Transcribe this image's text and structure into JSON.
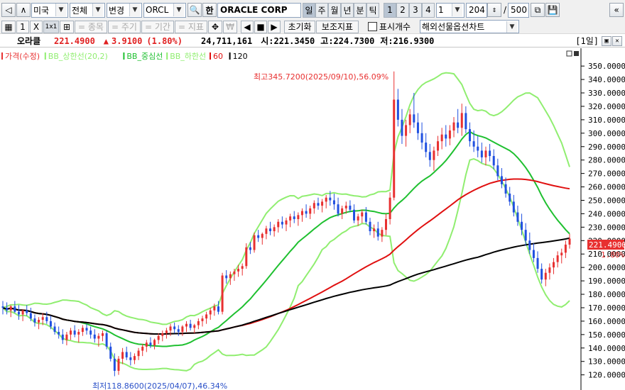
{
  "toolbar1": {
    "market": "미국",
    "scope": "전체",
    "change": "변경",
    "ticker": "ORCL",
    "hangul": "한",
    "company": "ORACLE CORP",
    "periods": [
      "일",
      "주",
      "월",
      "년",
      "분",
      "틱"
    ],
    "active_period": "일",
    "multi": [
      "1",
      "2",
      "3",
      "4"
    ],
    "interval": "1",
    "count": "204",
    "total_sep": "/",
    "total": "500"
  },
  "toolbar2": {
    "grid_nums": [
      "1",
      "X",
      "1x1"
    ],
    "disabled_buttons": [
      "= 종목",
      "= 주기",
      "= 기간",
      "= 지표"
    ],
    "buttons": [
      "초기화",
      "보조지표",
      "표시개수"
    ],
    "overseas": "해외선물옵션차트"
  },
  "info": {
    "name": "오라클",
    "price": "221.4900",
    "change_arrow": "▲",
    "change": "3.9100",
    "change_pct": "(1.80%)",
    "volume": "24,711,161",
    "open_label": "시:",
    "open": "221.3450",
    "high_label": "고:",
    "high": "224.7300",
    "low_label": "저:",
    "low": "216.9300",
    "pane_label": "[1일]"
  },
  "indicators": [
    {
      "label": "가격(수정)",
      "color": "#e83030"
    },
    {
      "label": "BB_상한선(20,2)",
      "color": "#90ee70"
    },
    {
      "label": "BB_중심선",
      "color": "#1fc030"
    },
    {
      "label": "BB_하한선",
      "color": "#90ee70"
    },
    {
      "label": "60",
      "color": "#e01010"
    },
    {
      "label": "120",
      "color": "#000000"
    }
  ],
  "annotations": {
    "high": "최고345.7200(2025/09/10),56.09%",
    "low": "최저118.8600(2025/04/07),46.34%"
  },
  "y_axis": {
    "ticks": [
      "350.0000",
      "340.0000",
      "330.0000",
      "320.0000",
      "310.0000",
      "300.0000",
      "290.0000",
      "280.0000",
      "270.0000",
      "260.0000",
      "250.0000",
      "240.0000",
      "230.0000",
      "220.0000",
      "210.0000",
      "200.0000",
      "190.0000",
      "180.0000",
      "170.0000",
      "160.0000",
      "150.0000",
      "140.0000",
      "130.0000",
      "120.0000"
    ],
    "current_price": "221.4900",
    "current_pct": "1.80%"
  },
  "colors": {
    "up": "#e83030",
    "down": "#2050e0",
    "bb_band": "#90ee70",
    "bb_mid": "#1fc030",
    "ma60": "#e01010",
    "ma120": "#000000"
  },
  "chart_data": {
    "type": "candlestick",
    "y_range": [
      114,
      358
    ],
    "candles": [
      [
        171,
        175,
        165,
        170
      ],
      [
        170,
        174,
        165,
        168
      ],
      [
        168,
        172,
        163,
        171
      ],
      [
        171,
        175,
        166,
        167
      ],
      [
        167,
        172,
        161,
        165
      ],
      [
        165,
        169,
        160,
        168
      ],
      [
        168,
        172,
        164,
        166
      ],
      [
        166,
        170,
        160,
        162
      ],
      [
        162,
        165,
        156,
        159
      ],
      [
        159,
        163,
        154,
        161
      ],
      [
        161,
        166,
        157,
        163
      ],
      [
        163,
        167,
        158,
        160
      ],
      [
        160,
        164,
        154,
        156
      ],
      [
        156,
        159,
        150,
        152
      ],
      [
        152,
        156,
        147,
        150
      ],
      [
        150,
        154,
        143,
        146
      ],
      [
        146,
        152,
        142,
        150
      ],
      [
        150,
        155,
        146,
        153
      ],
      [
        153,
        157,
        148,
        150
      ],
      [
        150,
        154,
        144,
        152
      ],
      [
        152,
        157,
        149,
        155
      ],
      [
        155,
        158,
        150,
        153
      ],
      [
        153,
        156,
        147,
        150
      ],
      [
        150,
        154,
        144,
        147
      ],
      [
        147,
        151,
        141,
        149
      ],
      [
        149,
        153,
        145,
        151
      ],
      [
        151,
        153,
        139,
        141
      ],
      [
        141,
        144,
        130,
        132
      ],
      [
        132,
        136,
        119,
        123
      ],
      [
        123,
        134,
        120,
        132
      ],
      [
        132,
        140,
        128,
        137
      ],
      [
        137,
        141,
        131,
        133
      ],
      [
        133,
        137,
        127,
        131
      ],
      [
        131,
        136,
        128,
        134
      ],
      [
        134,
        140,
        131,
        138
      ],
      [
        138,
        143,
        134,
        141
      ],
      [
        141,
        146,
        137,
        144
      ],
      [
        144,
        148,
        140,
        142
      ],
      [
        142,
        147,
        139,
        146
      ],
      [
        146,
        151,
        143,
        149
      ],
      [
        149,
        153,
        145,
        151
      ],
      [
        151,
        155,
        147,
        153
      ],
      [
        153,
        158,
        149,
        156
      ],
      [
        156,
        159,
        151,
        154
      ],
      [
        154,
        157,
        149,
        152
      ],
      [
        152,
        157,
        149,
        156
      ],
      [
        156,
        160,
        152,
        158
      ],
      [
        158,
        161,
        153,
        155
      ],
      [
        155,
        158,
        151,
        157
      ],
      [
        157,
        162,
        154,
        160
      ],
      [
        160,
        164,
        156,
        162
      ],
      [
        162,
        167,
        158,
        165
      ],
      [
        165,
        170,
        161,
        168
      ],
      [
        168,
        173,
        164,
        171
      ],
      [
        171,
        175,
        165,
        167
      ],
      [
        167,
        196,
        165,
        194
      ],
      [
        194,
        198,
        188,
        192
      ],
      [
        192,
        197,
        187,
        195
      ],
      [
        195,
        199,
        190,
        197
      ],
      [
        197,
        202,
        193,
        199
      ],
      [
        199,
        203,
        194,
        201
      ],
      [
        201,
        218,
        199,
        215
      ],
      [
        215,
        219,
        210,
        213
      ],
      [
        213,
        226,
        211,
        224
      ],
      [
        224,
        228,
        219,
        222
      ],
      [
        222,
        226,
        217,
        225
      ],
      [
        225,
        231,
        221,
        229
      ],
      [
        229,
        234,
        224,
        227
      ],
      [
        227,
        232,
        223,
        230
      ],
      [
        230,
        236,
        226,
        234
      ],
      [
        234,
        238,
        229,
        232
      ],
      [
        232,
        237,
        227,
        235
      ],
      [
        235,
        240,
        230,
        238
      ],
      [
        238,
        242,
        233,
        236
      ],
      [
        236,
        241,
        231,
        239
      ],
      [
        239,
        244,
        234,
        242
      ],
      [
        242,
        247,
        237,
        240
      ],
      [
        240,
        246,
        236,
        244
      ],
      [
        244,
        250,
        240,
        248
      ],
      [
        248,
        252,
        243,
        246
      ],
      [
        246,
        251,
        241,
        249
      ],
      [
        249,
        254,
        244,
        252
      ],
      [
        252,
        257,
        246,
        250
      ],
      [
        250,
        255,
        243,
        247
      ],
      [
        247,
        252,
        238,
        240
      ],
      [
        240,
        246,
        236,
        244
      ],
      [
        244,
        249,
        240,
        246
      ],
      [
        246,
        250,
        241,
        243
      ],
      [
        243,
        247,
        233,
        235
      ],
      [
        235,
        240,
        231,
        238
      ],
      [
        238,
        243,
        233,
        241
      ],
      [
        241,
        245,
        232,
        234
      ],
      [
        234,
        237,
        224,
        227
      ],
      [
        227,
        232,
        222,
        229
      ],
      [
        229,
        234,
        220,
        223
      ],
      [
        223,
        230,
        219,
        228
      ],
      [
        228,
        240,
        224,
        236
      ],
      [
        236,
        256,
        232,
        252
      ],
      [
        252,
        346,
        250,
        325
      ],
      [
        325,
        333,
        305,
        310
      ],
      [
        310,
        318,
        292,
        298
      ],
      [
        298,
        310,
        290,
        306
      ],
      [
        306,
        318,
        300,
        314
      ],
      [
        314,
        330,
        304,
        308
      ],
      [
        308,
        315,
        295,
        300
      ],
      [
        300,
        308,
        288,
        293
      ],
      [
        293,
        300,
        282,
        286
      ],
      [
        286,
        292,
        275,
        280
      ],
      [
        280,
        290,
        272,
        287
      ],
      [
        287,
        298,
        283,
        294
      ],
      [
        294,
        304,
        288,
        299
      ],
      [
        299,
        306,
        290,
        296
      ],
      [
        296,
        306,
        291,
        302
      ],
      [
        302,
        312,
        297,
        308
      ],
      [
        308,
        318,
        300,
        304
      ],
      [
        304,
        322,
        298,
        315
      ],
      [
        315,
        320,
        300,
        303
      ],
      [
        303,
        308,
        290,
        294
      ],
      [
        294,
        302,
        286,
        290
      ],
      [
        290,
        298,
        282,
        287
      ],
      [
        287,
        293,
        278,
        282
      ],
      [
        282,
        290,
        276,
        287
      ],
      [
        287,
        292,
        279,
        283
      ],
      [
        283,
        288,
        273,
        276
      ],
      [
        276,
        281,
        265,
        268
      ],
      [
        268,
        274,
        259,
        262
      ],
      [
        262,
        267,
        252,
        255
      ],
      [
        255,
        260,
        246,
        249
      ],
      [
        249,
        254,
        238,
        241
      ],
      [
        241,
        246,
        231,
        234
      ],
      [
        234,
        240,
        224,
        228
      ],
      [
        228,
        233,
        216,
        220
      ],
      [
        220,
        226,
        210,
        213
      ],
      [
        213,
        218,
        204,
        207
      ],
      [
        207,
        212,
        196,
        199
      ],
      [
        199,
        203,
        188,
        191
      ],
      [
        191,
        199,
        186,
        196
      ],
      [
        196,
        203,
        191,
        200
      ],
      [
        200,
        207,
        195,
        204
      ],
      [
        204,
        212,
        200,
        209
      ],
      [
        209,
        214,
        203,
        211
      ],
      [
        211,
        220,
        207,
        217
      ],
      [
        217,
        225,
        214,
        221.49
      ]
    ]
  }
}
